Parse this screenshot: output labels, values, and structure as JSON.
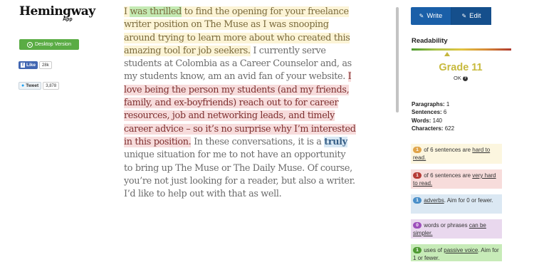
{
  "app": {
    "logo": "Hemingway",
    "logo_sub": "App",
    "desktop_button": "Desktop Version"
  },
  "social": {
    "fb_label": "Like",
    "fb_count": "28k",
    "tw_label": "Tweet",
    "tw_count": "3,878"
  },
  "editor": {
    "s1_pre": "I ",
    "s1_passive": "was thrilled",
    "s1_post": " to find the opening for your freelance writer position on The Muse as I was snooping around trying to learn more about who created this amazing tool for job seekers.",
    "s2": " I currently serve students at Colombia as a Career Counselor and, as my students know, am an avid fan of your website. ",
    "s3": "I love being the person my students (and my friends, family, and ex-boyfriends) reach out to for career resources, job and networking leads, and timely career advice – so it’s no surprise why I’m interested in this position.",
    "s4_pre": " In these conversations, it is a ",
    "s4_adverb": "truly",
    "s4_post": " unique situation for me to not have an opportunity to bring up The Muse or The Daily Muse. Of course, you’re not just looking for a reader, but also a writer. I’d like to help out with that as well."
  },
  "toolbar": {
    "write_label": "Write",
    "edit_label": "Edit"
  },
  "readability": {
    "label": "Readability",
    "grade": "Grade 11",
    "ok": "OK"
  },
  "stats": {
    "paragraphs_label": "Paragraphs:",
    "paragraphs": "1",
    "sentences_label": "Sentences:",
    "sentences": "6",
    "words_label": "Words:",
    "words": "140",
    "characters_label": "Characters:",
    "characters": "622"
  },
  "cards": {
    "hard": {
      "count": "1",
      "text1": "of 6 sentences are ",
      "link": "hard to read."
    },
    "very_hard": {
      "count": "1",
      "text1": "of 6 sentences are ",
      "link": "very hard to read."
    },
    "adverbs": {
      "count": "1",
      "link": "adverbs",
      "text2": ". Aim for 0 or fewer."
    },
    "simpler": {
      "count": "0",
      "text1": "words or phrases ",
      "link": "can be simpler."
    },
    "passive": {
      "count": "1",
      "text1": "uses of ",
      "link": "passive voice",
      "text2": ". Aim for 1 or fewer."
    }
  },
  "colors": {
    "accent_blue": "#1a5fa8",
    "green_button": "#5aac44",
    "grade_color": "#c8ba3e"
  }
}
